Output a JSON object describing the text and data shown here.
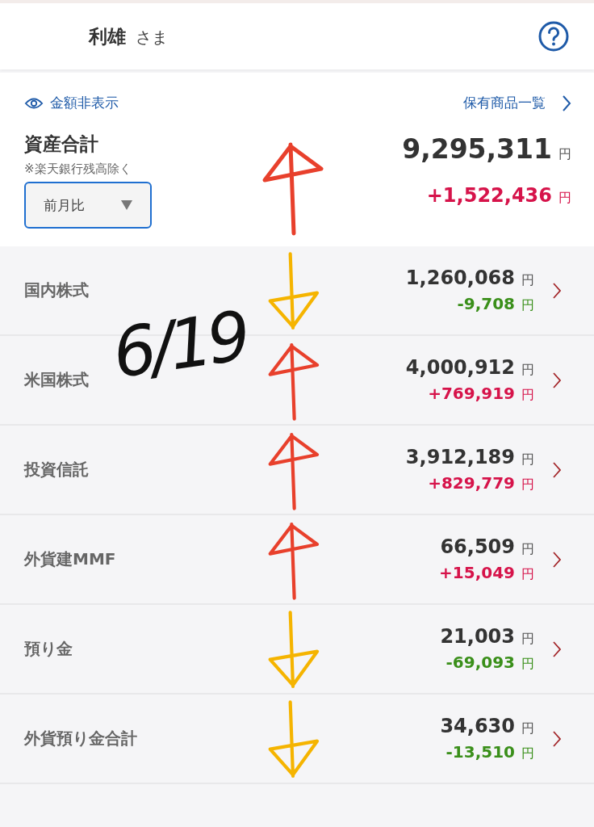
{
  "header": {
    "name": "利雄",
    "honorific": "さま"
  },
  "summary": {
    "hide_link": "金額非表示",
    "holdings_link": "保有商品一覧",
    "title": "資産合計",
    "note": "※楽天銀行残高除く",
    "period": "前月比",
    "total": "9,295,311",
    "total_unit": "円",
    "change": "+1,522,436",
    "change_unit": "円",
    "gain": true,
    "arrow_up": true
  },
  "rows": [
    {
      "name": "国内株式",
      "amount": "1,260,068",
      "unit": "円",
      "change": "-9,708",
      "change_unit": "円",
      "gain": false,
      "arrow_up": false
    },
    {
      "name": "米国株式",
      "amount": "4,000,912",
      "unit": "円",
      "change": "+769,919",
      "change_unit": "円",
      "gain": true,
      "arrow_up": true
    },
    {
      "name": "投資信託",
      "amount": "3,912,189",
      "unit": "円",
      "change": "+829,779",
      "change_unit": "円",
      "gain": true,
      "arrow_up": true
    },
    {
      "name": "外貨建MMF",
      "amount": "66,509",
      "unit": "円",
      "change": "+15,049",
      "change_unit": "円",
      "gain": true,
      "arrow_up": true
    },
    {
      "name": "預り金",
      "amount": "21,003",
      "unit": "円",
      "change": "-69,093",
      "change_unit": "円",
      "gain": false,
      "arrow_up": false
    },
    {
      "name": "外貨預り金合計",
      "amount": "34,630",
      "unit": "円",
      "change": "-13,510",
      "change_unit": "円",
      "gain": false,
      "arrow_up": false
    }
  ],
  "annotation": {
    "date": "6/19"
  }
}
